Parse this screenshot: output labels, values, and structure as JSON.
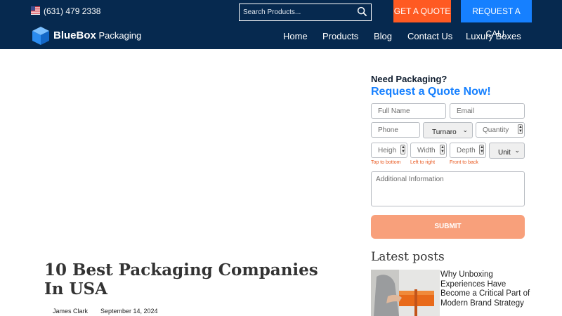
{
  "topbar": {
    "phone": "(631) 479 2338",
    "search_placeholder": "Search Products...",
    "get_quote": "GET A QUOTE",
    "request_call": "REQUEST A CALL"
  },
  "brand": {
    "name_bold": "BlueBox",
    "name_rest": "Packaging"
  },
  "nav": [
    "Home",
    "Products",
    "Blog",
    "Contact Us",
    "Luxury Boxes"
  ],
  "post": {
    "title": "10 Best Packaging Companies In USA",
    "author": "James Clark",
    "date": "September 14, 2024"
  },
  "quote_form": {
    "heading": "Need Packaging?",
    "subheading": "Request a Quote Now!",
    "full_name_placeholder": "Full Name",
    "email_placeholder": "Email",
    "phone_placeholder": "Phone",
    "turnaround_value": "Turnaro",
    "quantity_placeholder": "Quantity",
    "height_placeholder": "Heigh",
    "width_placeholder": "Width",
    "depth_placeholder": "Depth",
    "unit_value": "Unit",
    "hint_height": "Top to bottom",
    "hint_width": "Left to right",
    "hint_depth": "Front to back",
    "info_placeholder": "Additional Information",
    "submit": "SUBMIT"
  },
  "sidebar": {
    "latest_heading": "Latest posts",
    "latest_post_title": "Why Unboxing Experiences Have Become a Critical Part of Modern Brand Strategy"
  },
  "colors": {
    "header_bg": "#06294f",
    "accent_orange": "#ff5a22",
    "accent_blue": "#1680ff",
    "submit_bg": "#f8a07b"
  }
}
